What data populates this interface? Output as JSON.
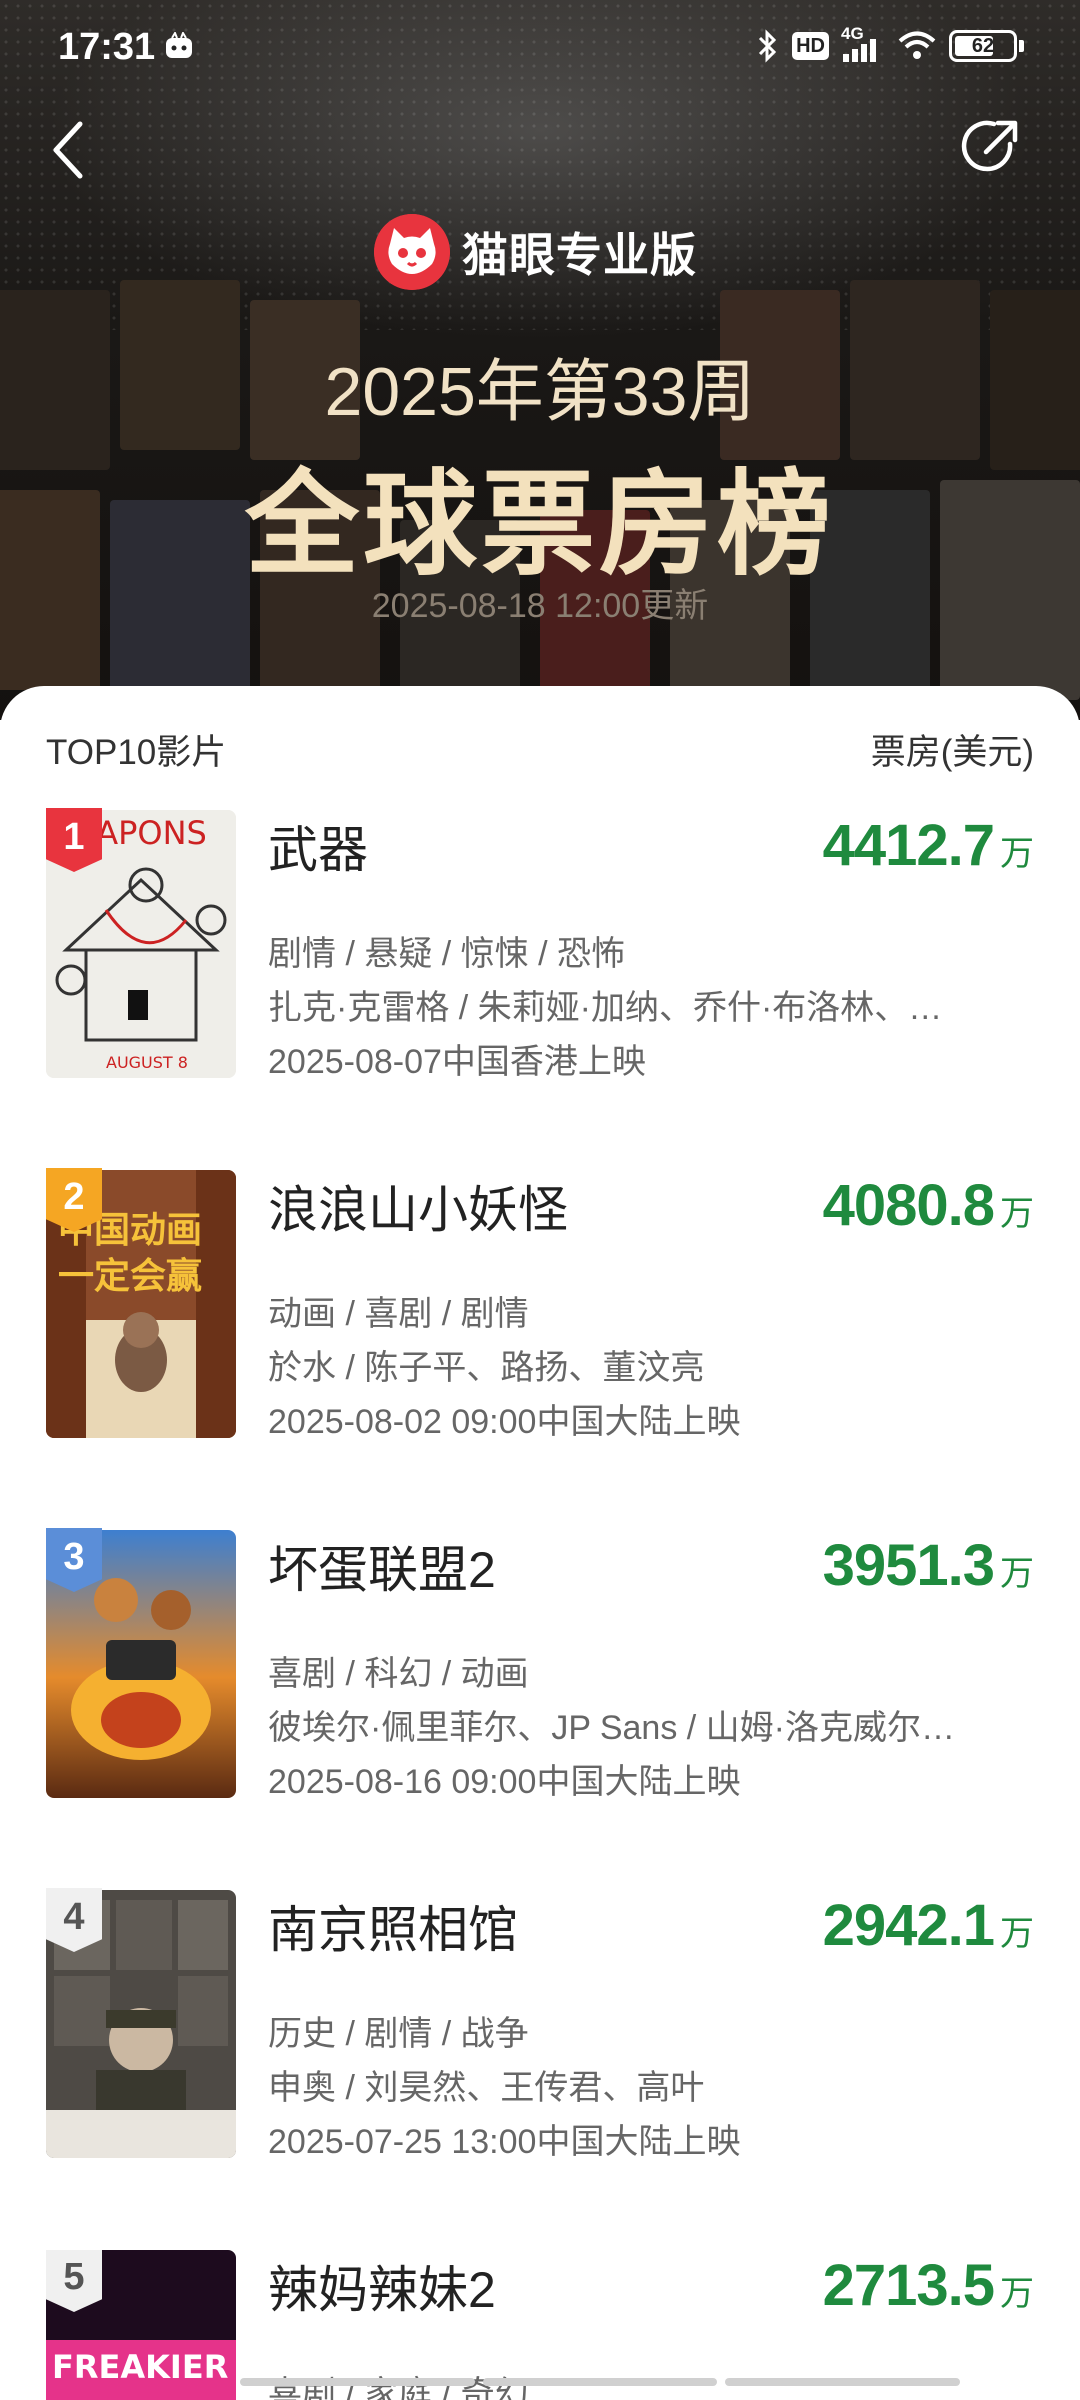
{
  "status_bar": {
    "time": "17:31",
    "network": "4G",
    "battery": "62",
    "hd_label": "HD"
  },
  "header": {
    "brand": "猫眼专业版",
    "week_title": "2025年第33周",
    "main_title": "全球票房榜",
    "update_time": "2025-08-18 12:00更新"
  },
  "list_header": {
    "left": "TOP10影片",
    "right": "票房(美元)"
  },
  "movies": [
    {
      "rank": "1",
      "title": "武器",
      "box": "4412.7",
      "unit": "万",
      "genres": "剧情 / 悬疑 / 惊悚 / 恐怖",
      "cast": "扎克·克雷格 / 朱莉娅·加纳、乔什·布洛林、…",
      "release": "2025-08-07中国香港上映",
      "badge_color": "#e8343e"
    },
    {
      "rank": "2",
      "title": "浪浪山小妖怪",
      "box": "4080.8",
      "unit": "万",
      "genres": "动画 / 喜剧 / 剧情",
      "cast": "於水 / 陈子平、路扬、董汶亮",
      "release": "2025-08-02 09:00中国大陆上映",
      "badge_color": "#f5a623"
    },
    {
      "rank": "3",
      "title": "坏蛋联盟2",
      "box": "3951.3",
      "unit": "万",
      "genres": "喜剧 / 科幻 / 动画",
      "cast": "彼埃尔·佩里菲尔、JP Sans / 山姆·洛克威尔…",
      "release": "2025-08-16 09:00中国大陆上映",
      "badge_color": "#5b8ed8"
    },
    {
      "rank": "4",
      "title": "南京照相馆",
      "box": "2942.1",
      "unit": "万",
      "genres": "历史 / 剧情 / 战争",
      "cast": "申奥 / 刘昊然、王传君、高叶",
      "release": "2025-07-25 13:00中国大陆上映",
      "badge_color": "#f0f0f0"
    },
    {
      "rank": "5",
      "title": "辣妈辣妹2",
      "box": "2713.5",
      "unit": "万",
      "genres": "喜剧 / 家庭 / 奇幻",
      "cast": "",
      "release": "",
      "badge_color": "#f0f0f0"
    }
  ],
  "colors": {
    "box_office_green": "#1f8a3e",
    "brand_red": "#e8343e",
    "title_gold": "#f3e1bd"
  }
}
